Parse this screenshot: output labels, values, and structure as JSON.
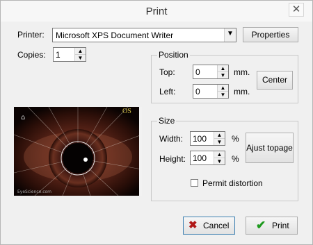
{
  "window": {
    "title": "Print",
    "close_glyph": "✕"
  },
  "printer": {
    "label": "Printer:",
    "value": "Microsoft XPS Document Writer",
    "properties_label": "Properties"
  },
  "copies": {
    "label": "Copies:",
    "value": "1"
  },
  "position": {
    "group_label": "Position",
    "top_label": "Top:",
    "top_value": "0",
    "left_label": "Left:",
    "left_value": "0",
    "unit": "mm.",
    "center_label": "Center"
  },
  "size": {
    "group_label": "Size",
    "width_label": "Width:",
    "width_value": "100",
    "height_label": "Height:",
    "height_value": "100",
    "unit": "%",
    "adjust_label": "Ajust topage",
    "permit_label": "Permit distortion",
    "permit_checked": false
  },
  "preview": {
    "eye_label": "OS",
    "watermark": "EyeScience.com"
  },
  "footer": {
    "cancel_label": "Cancel",
    "print_label": "Print"
  },
  "icons": {
    "cancel": "x-icon",
    "print": "checkmark-icon"
  },
  "colors": {
    "cancel_icon": "#b01818",
    "print_icon": "#1e9a1e",
    "eye_label": "#d9c64a"
  }
}
